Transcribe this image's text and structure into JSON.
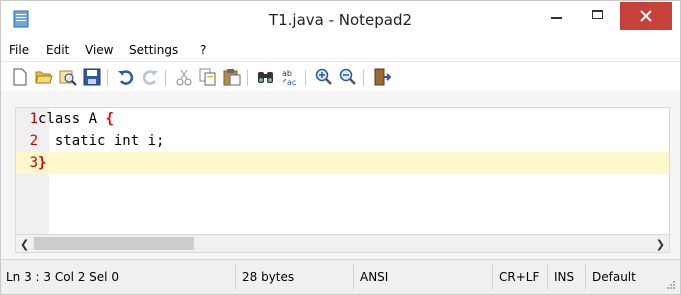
{
  "window": {
    "title": "T1.java - Notepad2",
    "colors": {
      "close": "#c7413a",
      "current_line": "#fff8cc",
      "line_number": "#cc0000"
    }
  },
  "menu": {
    "items": [
      "File",
      "Edit",
      "View",
      "Settings",
      "?"
    ]
  },
  "toolbar": {
    "buttons": [
      "new-file-icon",
      "open-folder-icon",
      "browse-icon",
      "save-icon",
      "undo-icon",
      "redo-icon",
      "cut-icon",
      "copy-icon",
      "paste-icon",
      "find-icon",
      "replace-icon",
      "zoom-in-icon",
      "zoom-out-icon",
      "exit-icon"
    ]
  },
  "editor": {
    "lines": [
      {
        "num": "1",
        "text": "class A ",
        "brace": "{"
      },
      {
        "num": "2",
        "text": "  static int i;",
        "brace": ""
      },
      {
        "num": "3",
        "text": "",
        "brace": "}"
      }
    ],
    "current_line": 3
  },
  "statusbar": {
    "position": "Ln 3 : 3   Col 2   Sel 0",
    "size": "28 bytes",
    "encoding": "ANSI",
    "eol": "CR+LF",
    "mode": "INS",
    "scheme": "Default"
  }
}
